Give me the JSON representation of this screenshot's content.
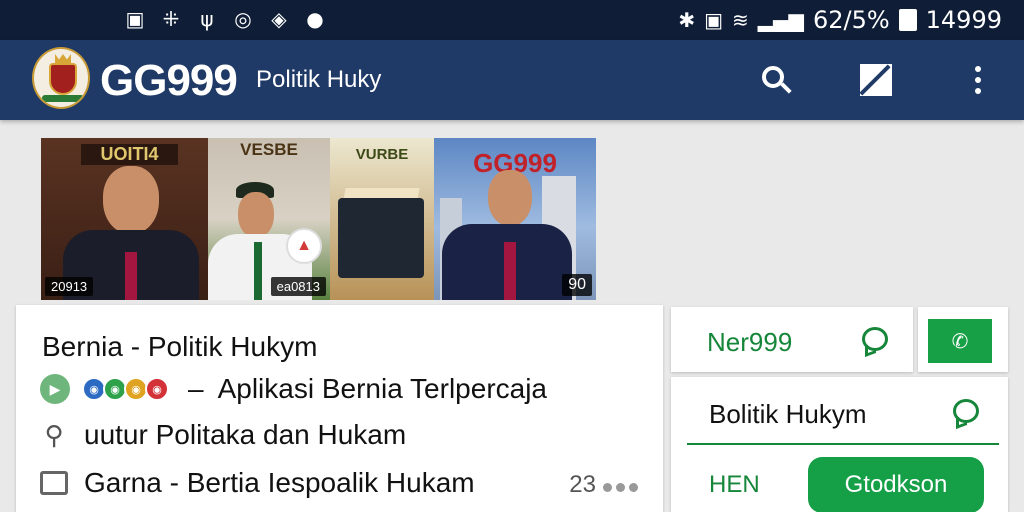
{
  "status": {
    "left_icons": [
      "image-icon",
      "grid-icon",
      "usb-icon",
      "sync-icon",
      "shield-icon",
      "location-icon"
    ],
    "battery": "62/5%",
    "time": "14999"
  },
  "app_bar": {
    "brand": "GG999",
    "subtitle": "Politik Huky",
    "accent": "#1f3a67"
  },
  "images": [
    {
      "title": "UOITI4",
      "badge": "20913"
    },
    {
      "title": "VESBE",
      "badge": "ea0813"
    },
    {
      "title": "VURBE"
    },
    {
      "title": "GG999",
      "badge": "90"
    }
  ],
  "main_card": {
    "title": "Bernia - Politik Hukym",
    "line1": "Aplikasi Bernia Terlpercaja",
    "line2": "uutur Politaka dan Hukam",
    "line3": "Garna - Bertia Iespoalik Hukam",
    "count": "23"
  },
  "side": {
    "tab1": "Ner999",
    "tab2": "Bolitik Hukym",
    "label": "HEN",
    "cta": "Gtodkson",
    "green": "#16a046"
  }
}
